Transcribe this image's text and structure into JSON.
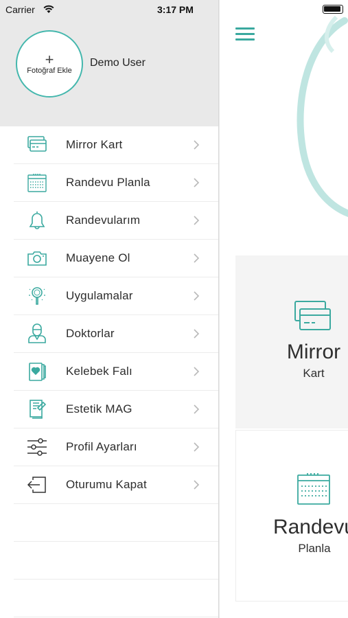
{
  "status_bar": {
    "carrier": "Carrier",
    "time": "3:17 PM"
  },
  "profile": {
    "photo_plus": "+",
    "photo_label": "Fotoğraf Ekle",
    "name": "Demo User"
  },
  "menu": [
    {
      "label": "Mirror Kart",
      "icon": "card-icon"
    },
    {
      "label": "Randevu Planla",
      "icon": "calendar-icon"
    },
    {
      "label": "Randevularım",
      "icon": "bell-icon"
    },
    {
      "label": "Muayene Ol",
      "icon": "camera-icon"
    },
    {
      "label": "Uygulamalar",
      "icon": "magnifier-icon"
    },
    {
      "label": "Doktorlar",
      "icon": "doctor-icon"
    },
    {
      "label": "Kelebek Falı",
      "icon": "heart-card-icon"
    },
    {
      "label": "Estetik MAG",
      "icon": "magazine-icon"
    },
    {
      "label": "Profil Ayarları",
      "icon": "sliders-icon"
    },
    {
      "label": "Oturumu Kapat",
      "icon": "logout-icon"
    }
  ],
  "cards": [
    {
      "title": "Mirror",
      "subtitle": "Kart",
      "icon": "card-icon"
    },
    {
      "title": "Randevu",
      "subtitle": "Planla",
      "icon": "calendar-icon"
    }
  ],
  "colors": {
    "accent": "#44b7ad",
    "header_bg": "#e9e9e9",
    "card_bg": "#f4f4f4"
  }
}
